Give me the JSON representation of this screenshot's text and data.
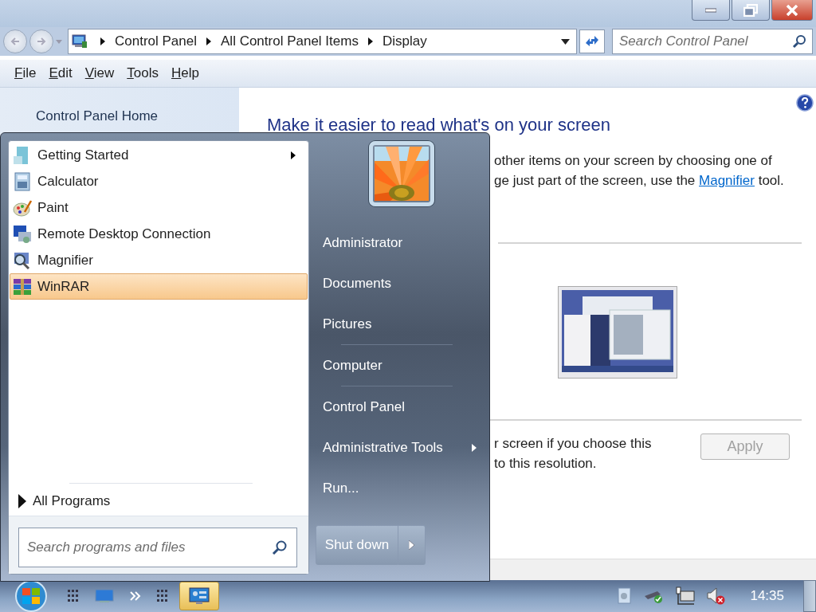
{
  "address_bar": {
    "breadcrumbs": [
      "Control Panel",
      "All Control Panel Items",
      "Display"
    ]
  },
  "search": {
    "placeholder": "Search Control Panel"
  },
  "menu_bar": [
    {
      "label": "File"
    },
    {
      "label": "Edit"
    },
    {
      "label": "View"
    },
    {
      "label": "Tools"
    },
    {
      "label": "Help"
    }
  ],
  "sidebar": {
    "items": [
      {
        "label": "Control Panel Home"
      }
    ]
  },
  "content": {
    "heading": "Make it easier to read what's on your screen",
    "intro_lines": [
      {
        "text": "other items on your screen by choosing one of"
      },
      {
        "text": "ge just part of the screen, use the ",
        "link": "Magnifier",
        "after": " tool."
      }
    ],
    "note_lines": [
      "r screen if you choose this",
      "to this resolution."
    ],
    "apply_button": {
      "label": "Apply",
      "disabled": true
    }
  },
  "start_menu": {
    "programs": [
      {
        "label": "Getting Started",
        "selected": false,
        "has_submenu": true
      },
      {
        "label": "Calculator",
        "selected": false,
        "has_submenu": false
      },
      {
        "label": "Paint",
        "selected": false,
        "has_submenu": false
      },
      {
        "label": "Remote Desktop Connection",
        "selected": false,
        "has_submenu": false
      },
      {
        "label": "Magnifier",
        "selected": false,
        "has_submenu": false
      },
      {
        "label": "WinRAR",
        "selected": true,
        "has_submenu": false
      }
    ],
    "all_programs": "All Programs",
    "search": {
      "placeholder": "Search programs and files"
    },
    "places": [
      {
        "label": "Administrator",
        "has_submenu": false,
        "divider_after": false
      },
      {
        "label": "Documents",
        "has_submenu": false,
        "divider_after": false
      },
      {
        "label": "Pictures",
        "has_submenu": false,
        "divider_after": true
      },
      {
        "label": "Computer",
        "has_submenu": false,
        "divider_after": true
      },
      {
        "label": "Control Panel",
        "has_submenu": false,
        "divider_after": false
      },
      {
        "label": "Administrative Tools",
        "has_submenu": true,
        "divider_after": false
      },
      {
        "label": "Run...",
        "has_submenu": false,
        "divider_after": false
      }
    ],
    "shutdown_button": {
      "label": "Shut down"
    }
  },
  "taskbar": {
    "clock": "14:35"
  }
}
